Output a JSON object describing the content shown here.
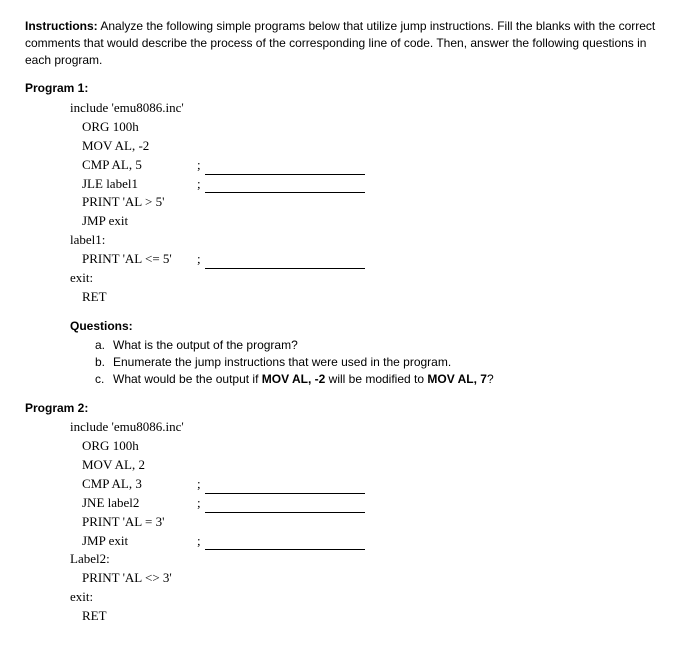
{
  "instructions": {
    "label": "Instructions:",
    "text": " Analyze the following simple programs below that utilize jump instructions. Fill the blanks with the correct comments that would describe the process of the corresponding line of code. Then, answer the following questions in each program."
  },
  "program1": {
    "title": "Program 1:",
    "lines": {
      "l0": "include 'emu8086.inc'",
      "l1": "ORG 100h",
      "l2": "MOV AL, -2",
      "l3": "CMP AL, 5",
      "l4": "JLE label1",
      "l5": "PRINT 'AL > 5'",
      "l6": "JMP exit",
      "l7": "label1:",
      "l8": "PRINT 'AL <= 5'",
      "l9": "exit:",
      "l10": "RET"
    },
    "semicolon": ";"
  },
  "questions": {
    "title": "Questions:",
    "a_letter": "a.",
    "a_text": "What is the output of the program?",
    "b_letter": "b.",
    "b_text": "Enumerate the jump instructions that were used in the program.",
    "c_letter": "c.",
    "c_text_1": "What would be the output if ",
    "c_bold_1": "MOV AL, -2",
    "c_text_2": " will be modified to ",
    "c_bold_2": "MOV AL, 7",
    "c_text_3": "?"
  },
  "program2": {
    "title": "Program 2:",
    "lines": {
      "l0": "include 'emu8086.inc'",
      "l1": "ORG 100h",
      "l2": "MOV AL, 2",
      "l3": "CMP AL, 3",
      "l4": "JNE label2",
      "l5": "PRINT 'AL = 3'",
      "l6": "JMP exit",
      "l7": "Label2:",
      "l8": "PRINT 'AL <> 3'",
      "l9": "exit:",
      "l10": "RET"
    },
    "semicolon": ";"
  }
}
